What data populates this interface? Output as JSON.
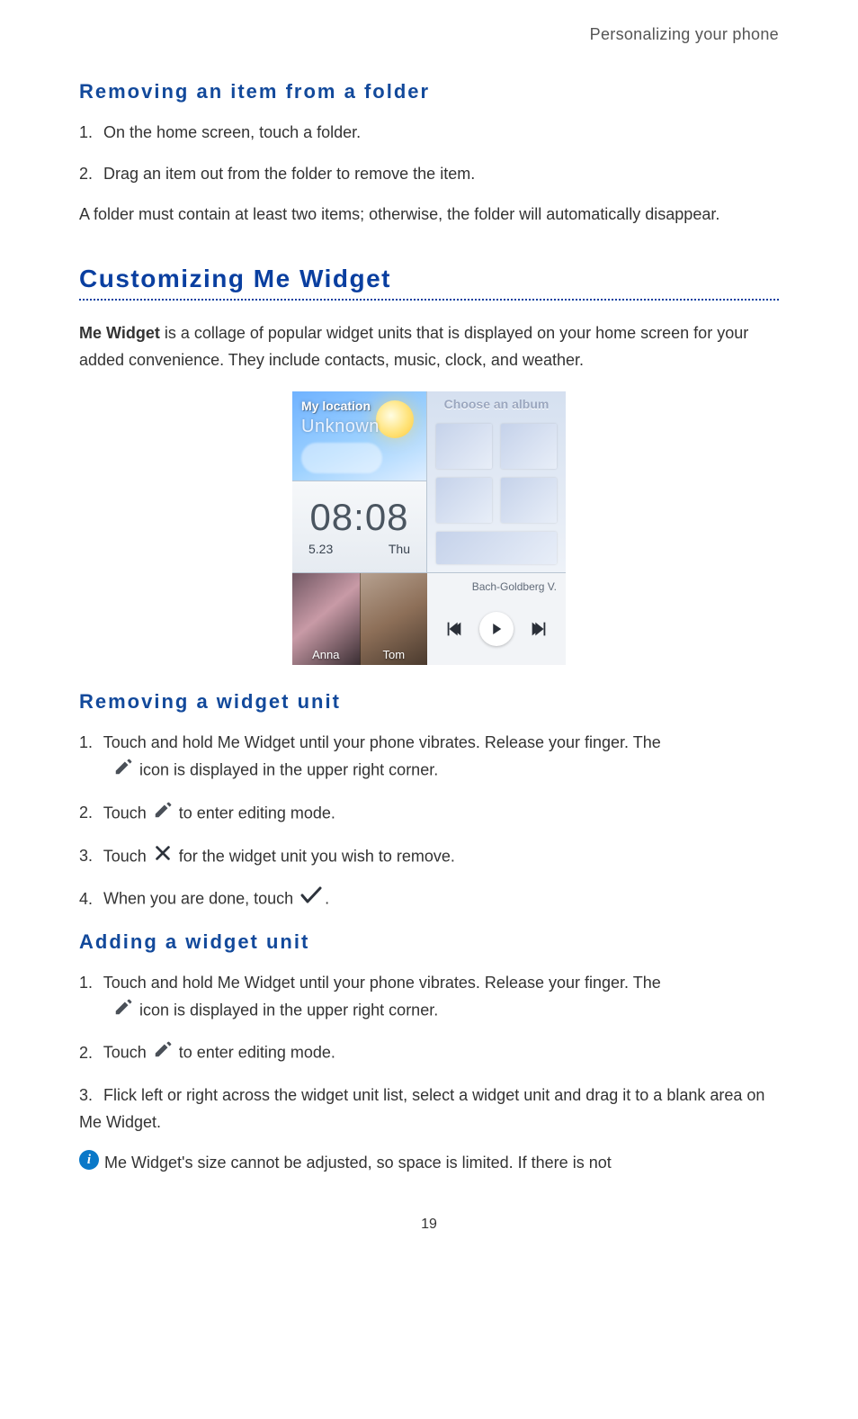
{
  "header": {
    "breadcrumb": "Personalizing your phone"
  },
  "section_remove_folder": {
    "title": "Removing an item from a folder",
    "steps": [
      "On the home screen, touch a folder.",
      "Drag an item out from the folder to remove the item."
    ],
    "note": "A folder must contain at least two items; otherwise, the folder will automatically disappear."
  },
  "section_customize": {
    "title": "Customizing Me Widget",
    "intro_bold": "Me Widget",
    "intro_rest": " is a collage of popular widget units that is displayed on your home screen for your added convenience. They include contacts, music, clock, and weather."
  },
  "figure": {
    "weather": {
      "location_label": "My location",
      "location_value": "Unknown"
    },
    "album": {
      "title": "Choose an album"
    },
    "clock": {
      "time": "08:08",
      "date": "5.23",
      "day": "Thu"
    },
    "contacts": [
      "Anna",
      "Tom"
    ],
    "music": {
      "track": "Bach-Goldberg V."
    }
  },
  "section_remove_unit": {
    "title": "Removing a widget unit",
    "step1": "Touch and hold Me Widget until your phone vibrates. Release your finger. The",
    "step1_cont": "icon is displayed in the upper right corner.",
    "step2_a": "Touch",
    "step2_b": "to enter editing mode.",
    "step3_a": "Touch",
    "step3_b": "for the widget unit you wish to remove.",
    "step4_a": "When you are done, touch",
    "step4_b": "."
  },
  "section_add_unit": {
    "title": "Adding a widget unit",
    "step1": "Touch and hold Me Widget until your phone vibrates. Release your finger. The",
    "step1_cont": "icon is displayed in the upper right corner.",
    "step2_a": "Touch",
    "step2_b": "to enter editing mode.",
    "step3": "Flick left or right across the widget unit list, select a widget unit and drag it to a blank area on Me Widget.",
    "info_note": "Me Widget's size cannot be adjusted, so space is limited. If there is not"
  },
  "page_number": "19"
}
